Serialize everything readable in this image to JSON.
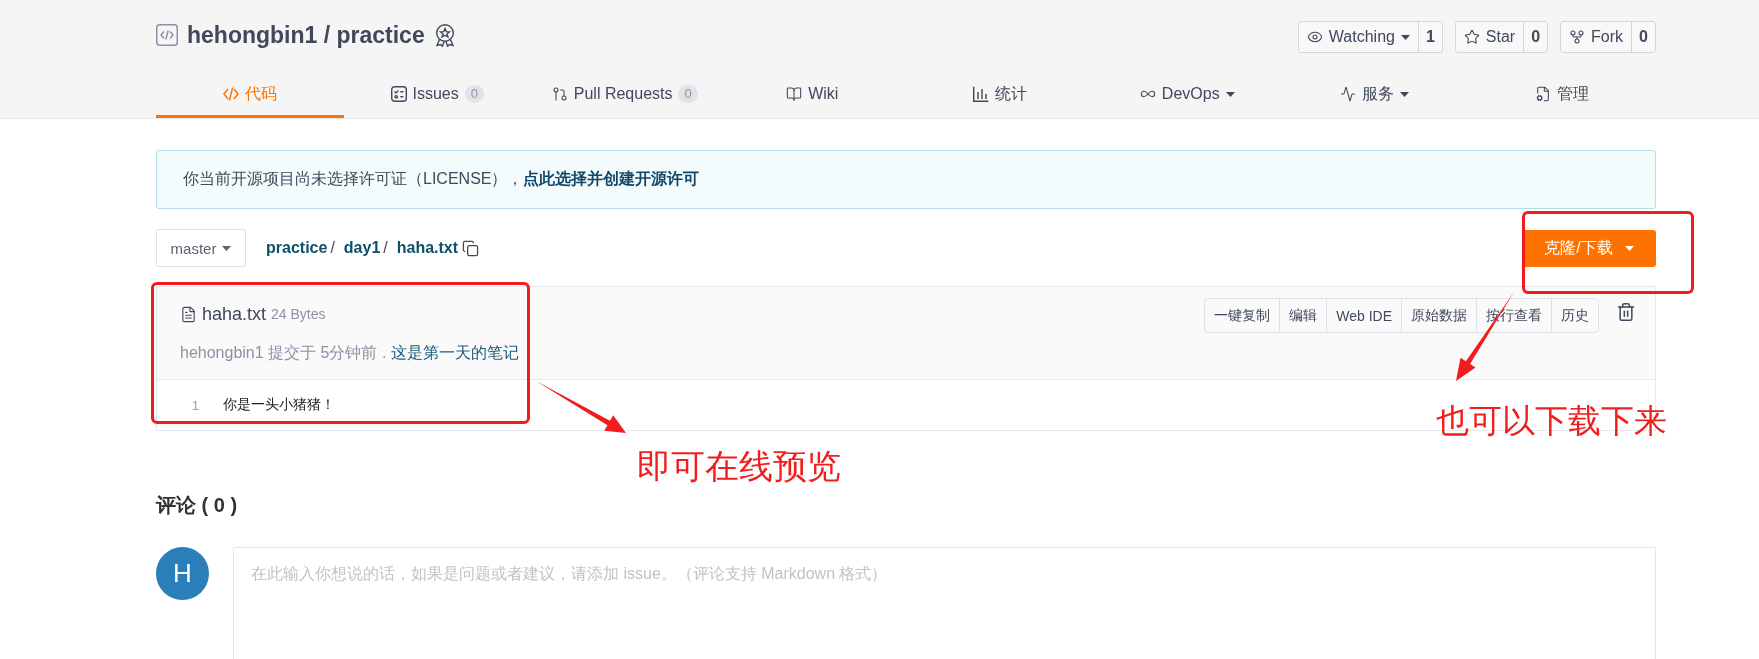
{
  "repository": {
    "title": "hehongbin1 / practice"
  },
  "actions": [
    {
      "label": "Watching",
      "count": "1",
      "kind": "menu"
    },
    {
      "label": "Star",
      "count": "0",
      "kind": "button"
    },
    {
      "label": "Fork",
      "count": "0",
      "kind": "button"
    }
  ],
  "tabs": [
    {
      "label": "代码",
      "selected": true,
      "kind": "link"
    },
    {
      "label": "Issues",
      "count": "0",
      "selected": false,
      "kind": "link"
    },
    {
      "label": "Pull Requests",
      "count": "0",
      "selected": false,
      "kind": "link"
    },
    {
      "label": "Wiki",
      "selected": false,
      "kind": "link"
    },
    {
      "label": "统计",
      "selected": false,
      "kind": "link"
    },
    {
      "label": "DevOps",
      "selected": false,
      "kind": "menu"
    },
    {
      "label": "服务",
      "selected": false,
      "kind": "menu"
    },
    {
      "label": "管理",
      "selected": false,
      "kind": "link"
    }
  ],
  "license_notice": {
    "text": "你当前开源项目尚未选择许可证（LICENSE），",
    "link": "点此选择并创建开源许可"
  },
  "branch": {
    "label": "master"
  },
  "breadcrumb": [
    {
      "label": "practice",
      "kind": "link"
    },
    {
      "label": "/",
      "kind": "separator"
    },
    {
      "label": "day1",
      "kind": "link"
    },
    {
      "label": "/",
      "kind": "separator"
    },
    {
      "label": "haha.txt",
      "kind": "current"
    }
  ],
  "clone_button": {
    "label": "克隆/下载"
  },
  "file": {
    "name": "haha.txt",
    "size": "24 Bytes",
    "commit_text": "hehongbin1 提交于 5分钟前 .",
    "commit_message": "这是第一天的笔记",
    "toolbar": [
      "一键复制",
      "编辑",
      "Web IDE",
      "原始数据",
      "按行查看",
      "历史"
    ],
    "lines": [
      {
        "number": "1",
        "text": "你是一头小猪猪！"
      }
    ]
  },
  "comments": {
    "title": "评论 ( 0 )",
    "avatar": "H",
    "placeholder": "在此输入你想说的话，如果是问题或者建议，请添加 issue。（评论支持 Markdown 格式）"
  },
  "annotations": [
    {
      "text": "即可在线预览"
    },
    {
      "text": "也可以下载下来"
    }
  ]
}
